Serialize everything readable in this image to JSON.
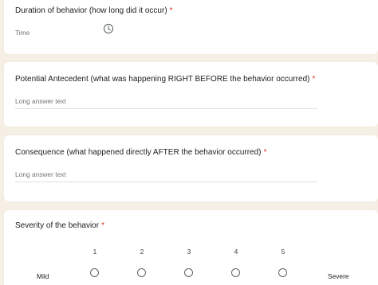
{
  "questions": [
    {
      "title": "Duration of behavior (how long did it occur)",
      "required_mark": "*",
      "placeholder": "Time",
      "icon": "clock-icon"
    },
    {
      "title": "Potential Antecedent (what was happening RIGHT BEFORE the behavior occurred)",
      "required_mark": "*",
      "placeholder": "Long answer text"
    },
    {
      "title": "Consequence (what happened directly AFTER the behavior occurred)",
      "required_mark": "*",
      "placeholder": "Long answer text"
    },
    {
      "title": "Severity of the behavior",
      "required_mark": "*",
      "scale": {
        "min_label": "Mild",
        "max_label": "Severe",
        "options": [
          "1",
          "2",
          "3",
          "4",
          "5"
        ]
      }
    }
  ],
  "colors": {
    "background": "#f5efe6",
    "required": "#d93025"
  }
}
